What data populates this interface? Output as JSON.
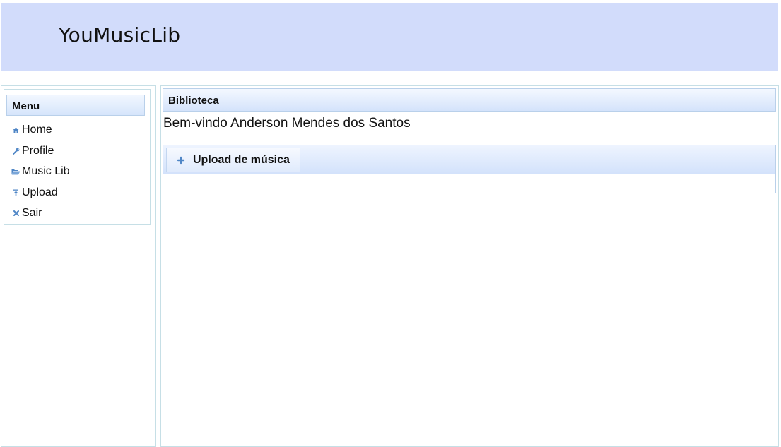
{
  "app": {
    "title": "YouMusicLib"
  },
  "menu": {
    "header": "Menu",
    "items": [
      {
        "label": "Home",
        "icon": "home-icon"
      },
      {
        "label": "Profile",
        "icon": "wrench-icon"
      },
      {
        "label": "Music Lib",
        "icon": "folder-open-icon"
      },
      {
        "label": "Upload",
        "icon": "upload-icon"
      },
      {
        "label": "Sair",
        "icon": "close-icon"
      }
    ]
  },
  "main": {
    "header": "Biblioteca",
    "welcome": "Bem-vindo Anderson Mendes dos Santos",
    "upload": {
      "button_label": "Upload de música",
      "icon": "plus-icon"
    }
  },
  "colors": {
    "header_bg": "#d2dcfb",
    "border": "#c6dfe6",
    "icon": "#4f86c6"
  }
}
